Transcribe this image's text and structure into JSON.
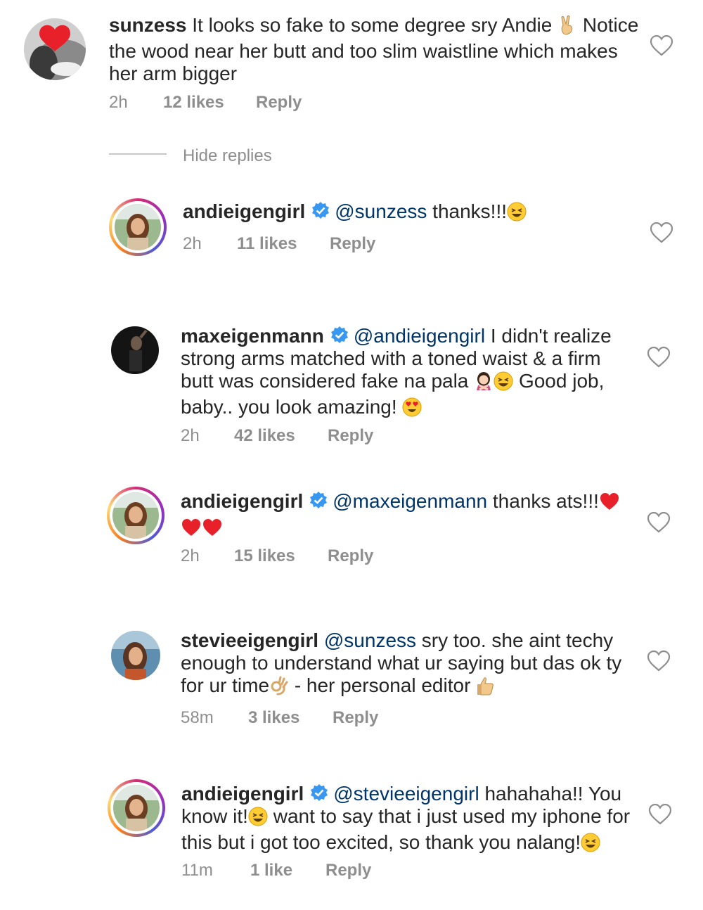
{
  "comments": [
    {
      "username": "sunzess",
      "verified": false,
      "mention": "",
      "lines": [
        "It looks so fake to some degree sry Andie",
        "Notice",
        "the wood near her butt and too slim waistline which makes",
        "her arm bigger"
      ],
      "time": "2h",
      "likes": "12 likes",
      "reply": "Reply"
    },
    {
      "username": "andieigengirl",
      "verified": true,
      "mention": "@sunzess",
      "lines": [
        "thanks!!!"
      ],
      "time": "2h",
      "likes": "11 likes",
      "reply": "Reply"
    },
    {
      "username": "maxeigenmann",
      "verified": true,
      "mention": "@andieigengirl",
      "lines": [
        "I didn't realize",
        "strong arms matched with a toned waist & a firm",
        "butt was considered fake na pala",
        "Good job,",
        "baby.. you look amazing!"
      ],
      "time": "2h",
      "likes": "42 likes",
      "reply": "Reply"
    },
    {
      "username": "andieigengirl",
      "verified": true,
      "mention": "@maxeigenmann",
      "lines": [
        "thanks ats!!!"
      ],
      "time": "2h",
      "likes": "15 likes",
      "reply": "Reply"
    },
    {
      "username": "stevieeigengirl",
      "verified": false,
      "mention": "@sunzess",
      "lines": [
        "sry too. she aint techy",
        "enough to understand what ur saying but das ok ty",
        "for ur time",
        "- her personal editor"
      ],
      "time": "58m",
      "likes": "3 likes",
      "reply": "Reply"
    },
    {
      "username": "andieigengirl",
      "verified": true,
      "mention": "@stevieeigengirl",
      "lines": [
        "hahahaha!! You",
        "know it!",
        "want to say that i just used my iphone for",
        "this but i got too excited, so thank you nalang!"
      ],
      "time": "11m",
      "likes": "1 like",
      "reply": "Reply"
    }
  ],
  "hide_replies": "Hide replies",
  "icons": {
    "like": "heart-outline-icon",
    "verified": "verified-badge-icon"
  },
  "colors": {
    "mention": "#003569",
    "meta": "#8e8e8e",
    "verified": "#3897f0"
  }
}
